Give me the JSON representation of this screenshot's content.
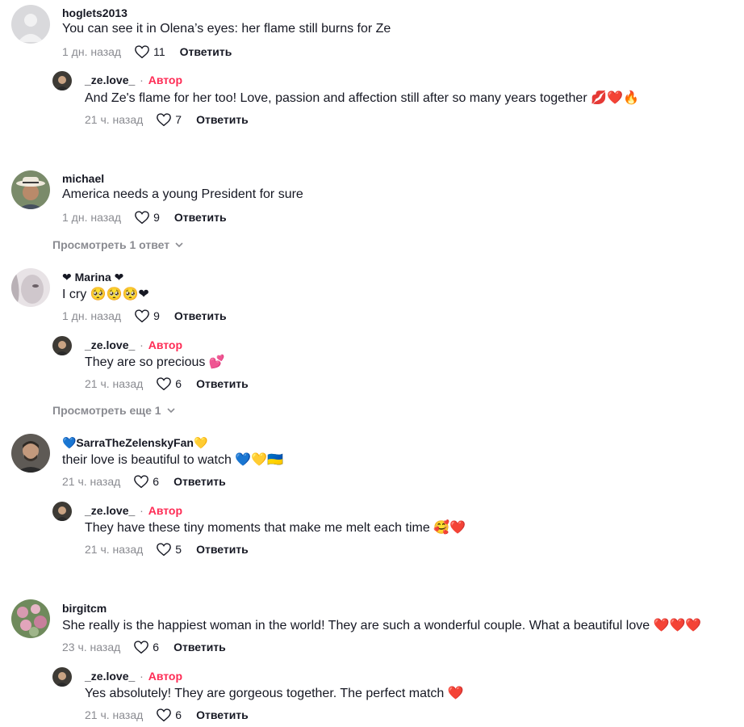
{
  "reply_label": "Ответить",
  "author_tag": "Автор",
  "comments": [
    {
      "username": "hoglets2013",
      "text": "You can see it in Olena’s eyes: her flame still burns for Ze",
      "time": "1 дн. назад",
      "likes": "11",
      "reply": {
        "username": "_ze.love_",
        "text": "And Ze's flame for her too! Love, passion and affection still after so many years together 💋❤️🔥",
        "time": "21 ч. назад",
        "likes": "7"
      }
    },
    {
      "username": "michael",
      "text": "America needs a young President for sure",
      "time": "1 дн. назад",
      "likes": "9",
      "view_more": "Просмотреть 1 ответ"
    },
    {
      "username": "❤ Marina ❤",
      "text": "I cry 🥺🥺🥺❤",
      "time": "1 дн. назад",
      "likes": "9",
      "reply": {
        "username": "_ze.love_",
        "text": "They are so precious 💕",
        "time": "21 ч. назад",
        "likes": "6"
      },
      "view_more": "Просмотреть еще 1"
    },
    {
      "username": "💙SarraTheZelenskyFan💛",
      "text": "their love is beautiful to watch 💙💛🇺🇦",
      "time": "21 ч. назад",
      "likes": "6",
      "reply": {
        "username": "_ze.love_",
        "text": "They have these tiny moments that make me melt each time 🥰❤️",
        "time": "21 ч. назад",
        "likes": "5"
      }
    },
    {
      "username": "birgitcm",
      "text": "She really is the happiest woman in the world! They are such a wonderful couple. What a beautiful love ❤️❤️❤️",
      "time": "23 ч. назад",
      "likes": "6",
      "reply": {
        "username": "_ze.love_",
        "text": "Yes absolutely! They are gorgeous together. The perfect match ❤️",
        "time": "21 ч. назад",
        "likes": "6"
      }
    }
  ]
}
